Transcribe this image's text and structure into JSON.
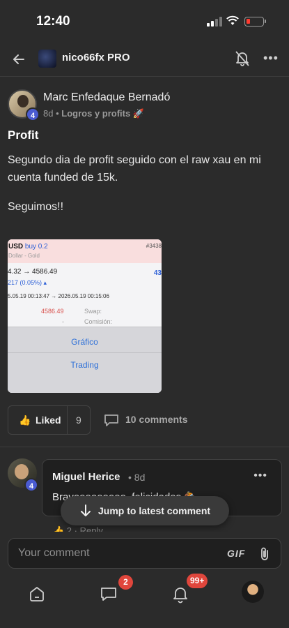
{
  "status_bar": {
    "time": "12:40"
  },
  "header": {
    "group_name": "nico66fx PRO",
    "icons": [
      "back-arrow-icon",
      "bell-off-icon",
      "more-icon"
    ]
  },
  "post": {
    "author": "Marc Enfedaque Bernadó",
    "level": "4",
    "age": "8d",
    "separator": "•",
    "category": "Logros y profits 🚀",
    "title": "Profit",
    "body": "Segundo dia de profit seguido con el raw xau en mi cuenta funded de 15k.",
    "body2": "Seguimos!!",
    "image": {
      "symbol": "USD",
      "side": "buy 0.2",
      "subtitle": "Dollar - Gold",
      "ticket": "#3438",
      "price_line": "4.32 → 4586.49",
      "right_value": "43",
      "change": "217 (0.05%) ▴",
      "dates": "5.05.19 00:13:47 → 2026.05.19 00:15:06",
      "price": "4586.49",
      "swap_label": "Swap:",
      "dash": "-",
      "commission_label": "Comisión:",
      "action1": "Gráfico",
      "action2": "Trading"
    }
  },
  "actions": {
    "liked_label": "Liked",
    "like_count": "9",
    "comments_label": "10 comments"
  },
  "comment": {
    "author": "Miguel Herice",
    "time": "• 8d",
    "level": "4",
    "text": "Bravooooooooo, felicidades 🏇",
    "actions": "👍 2 · Reply"
  },
  "jump_button": {
    "label": "Jump to latest comment"
  },
  "composer": {
    "placeholder": "Your comment",
    "gif_label": "GIF"
  },
  "tabbar": {
    "chat_badge": "2",
    "notifications_badge": "99+"
  },
  "colors": {
    "background": "#2b2b2b",
    "accent": "#4a5bd0",
    "badge": "#e0463c"
  }
}
